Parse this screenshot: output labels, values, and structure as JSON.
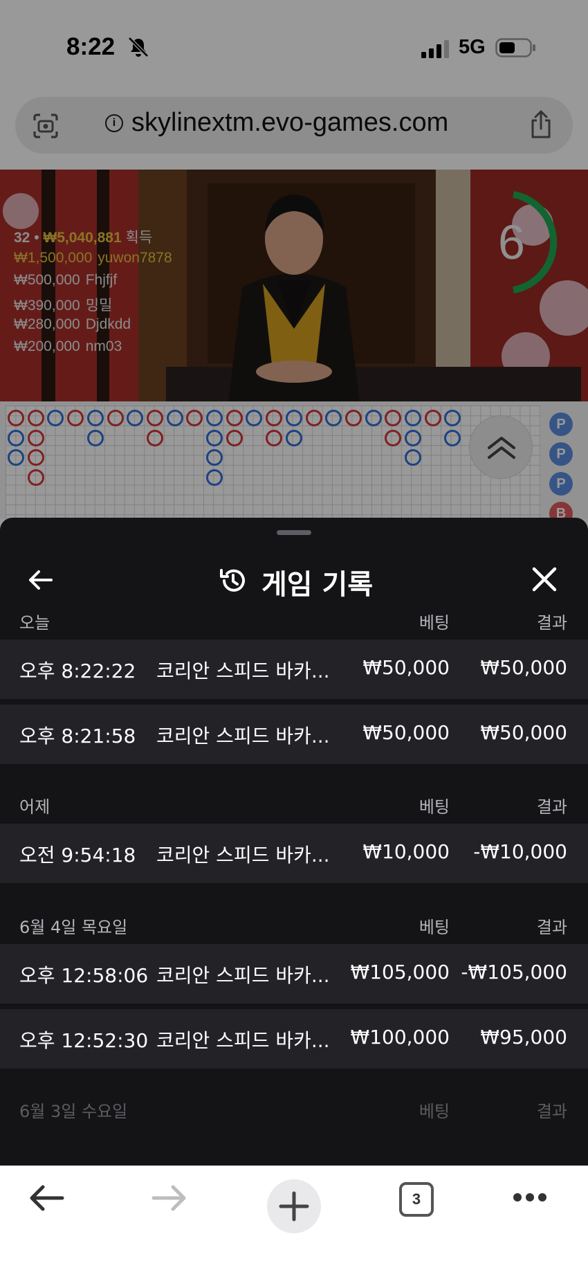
{
  "status_bar": {
    "time": "8:22",
    "network": "5G",
    "icons": [
      "bell-slash-icon",
      "signal-icon",
      "battery-icon"
    ]
  },
  "browser": {
    "url": "skylinextm.evo-games.com",
    "icons": [
      "camera-scan-icon",
      "info-icon",
      "share-icon"
    ]
  },
  "video": {
    "timer": "6",
    "winners_summary": {
      "count": "32",
      "amount": "₩5,040,881",
      "label": "획득"
    },
    "winners": [
      {
        "amount": "₩1,500,000",
        "name": "yuwon7878"
      },
      {
        "amount": "₩500,000",
        "name": "Fhjfjf"
      },
      {
        "amount": "₩390,000",
        "name": "밍밀"
      },
      {
        "amount": "₩280,000",
        "name": "Djdkdd"
      },
      {
        "amount": "₩200,000",
        "name": "nm03"
      }
    ]
  },
  "side_road": [
    "P",
    "P",
    "P",
    "B"
  ],
  "sheet": {
    "title": "게임 기록",
    "icons": [
      "back-arrow-icon",
      "history-icon",
      "close-icon"
    ],
    "sections": [
      {
        "label": "오늘",
        "bet_header": "베팅",
        "result_header": "결과",
        "rows": [
          {
            "time": "오후 8:22:22",
            "game": "코리안 스피드 바카...",
            "bet": "₩50,000",
            "result": "₩50,000"
          },
          {
            "time": "오후 8:21:58",
            "game": "코리안 스피드 바카...",
            "bet": "₩50,000",
            "result": "₩50,000"
          }
        ]
      },
      {
        "label": "어제",
        "bet_header": "베팅",
        "result_header": "결과",
        "rows": [
          {
            "time": "오전 9:54:18",
            "game": "코리안 스피드 바카...",
            "bet": "₩10,000",
            "result": "-₩10,000"
          }
        ]
      },
      {
        "label": "6월 4일 목요일",
        "bet_header": "베팅",
        "result_header": "결과",
        "rows": [
          {
            "time": "오후 12:58:06",
            "game": "코리안 스피드 바카...",
            "bet": "₩105,000",
            "result": "-₩105,000"
          },
          {
            "time": "오후 12:52:30",
            "game": "코리안 스피드 바카...",
            "bet": "₩100,000",
            "result": "₩95,000"
          }
        ]
      },
      {
        "label": "6월 3일 수요일",
        "bet_header": "베팅",
        "result_header": "결과",
        "rows": []
      }
    ]
  },
  "toolbar": {
    "tab_count": "3",
    "icons": [
      "back-icon",
      "forward-icon",
      "new-tab-icon",
      "tabs-icon",
      "more-icon"
    ]
  }
}
